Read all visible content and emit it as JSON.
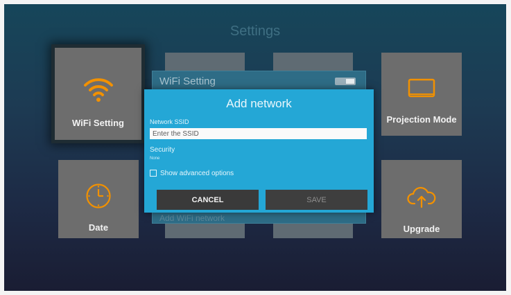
{
  "screen": {
    "title": "Settings"
  },
  "tiles": {
    "wifi": {
      "label": "WiFi Setting"
    },
    "projection": {
      "label": "Projection Mode"
    },
    "date": {
      "label": "Date"
    },
    "upgrade": {
      "label": "Upgrade"
    }
  },
  "wifi_panel": {
    "title": "WiFi Setting",
    "add_network_item": "Add WiFi network"
  },
  "dialog": {
    "title": "Add network",
    "ssid_label": "Network SSID",
    "ssid_placeholder": "Enter the SSID",
    "ssid_value": "",
    "security_label": "Security",
    "security_value": "None",
    "advanced_label": "Show advanced options",
    "advanced_checked": false,
    "cancel_label": "CANCEL",
    "save_label": "SAVE"
  },
  "colors": {
    "accent": "#f29100",
    "dialog_bg": "#24a7d6",
    "tile_bg": "#6d6d6d",
    "button_bg": "#3a3a3a"
  },
  "icons": {
    "wifi": "wifi-icon",
    "projection": "monitor-icon",
    "date": "clock-icon",
    "upgrade": "cloud-upload-icon"
  }
}
